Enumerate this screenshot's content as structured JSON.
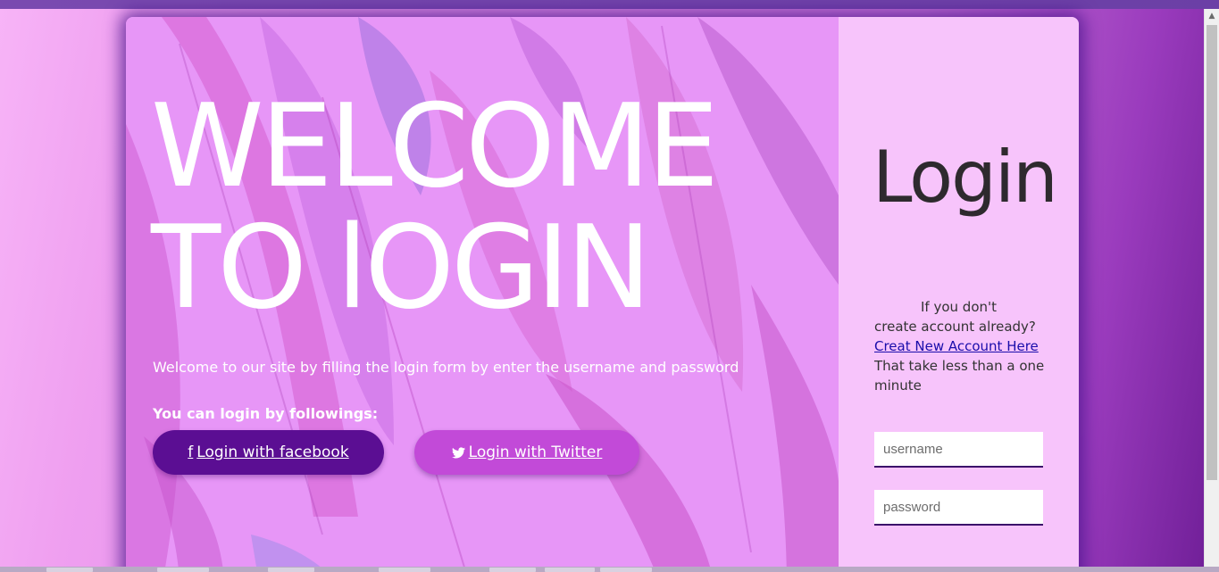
{
  "hero": {
    "heading": "WELCOME\nTO lOGIN",
    "intro": "Welcome to our site by filling the login form by enter the username and password",
    "follow_label": "You can login by followings:"
  },
  "social": {
    "facebook": {
      "label": "Login with facebook",
      "icon": "f"
    },
    "twitter": {
      "label": " Login with Twitter",
      "icon": "🐦︎"
    }
  },
  "login": {
    "title": "Login",
    "account_line1": "If you don't",
    "account_line2": "create account already?",
    "account_link": "Creat New Account Here",
    "account_line3": "That take less than a one minute",
    "username_placeholder": "username",
    "password_placeholder": "password"
  },
  "colors": {
    "facebook_button": "#5b0e93",
    "twitter_button": "#c24ad8",
    "left_panel": "#e796f7",
    "right_panel": "#f7c4fb"
  }
}
